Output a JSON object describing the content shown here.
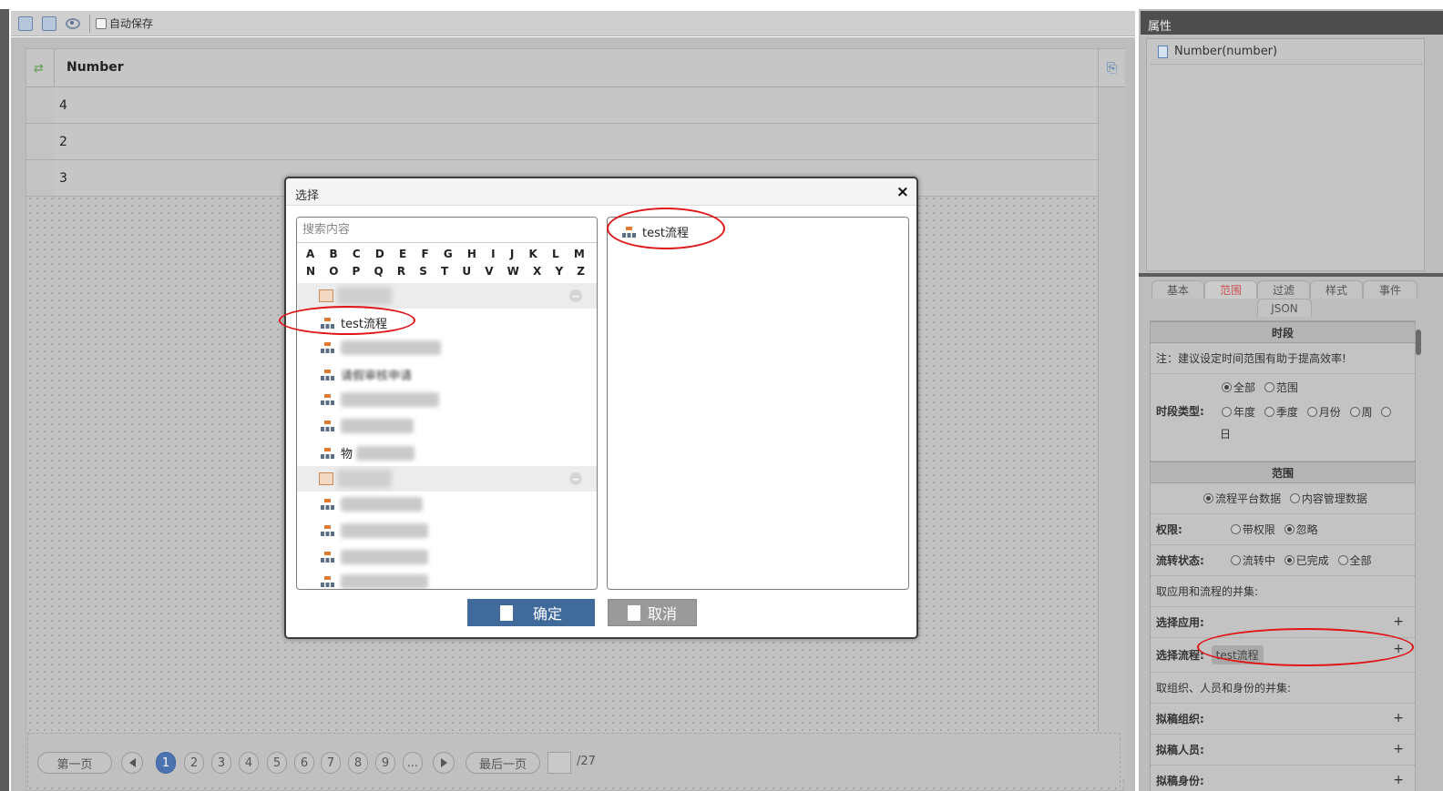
{
  "toolbar": {
    "autosave_label": "自动保存"
  },
  "grid": {
    "column_title": "Number",
    "rows": [
      "4",
      "2",
      "3"
    ]
  },
  "pager": {
    "first": "第一页",
    "pages": [
      "1",
      "2",
      "3",
      "4",
      "5",
      "6",
      "7",
      "8",
      "9"
    ],
    "ellipsis": "...",
    "last": "最后一页",
    "total": "/27",
    "current": "1"
  },
  "dialog": {
    "title": "选择",
    "close": "×",
    "search_placeholder": "搜索内容",
    "letters_row1": [
      "A",
      "B",
      "C",
      "D",
      "E",
      "F",
      "G",
      "H",
      "I",
      "J",
      "K",
      "L",
      "M"
    ],
    "letters_row2": [
      "N",
      "O",
      "P",
      "Q",
      "R",
      "S",
      "T",
      "U",
      "V",
      "W",
      "X",
      "Y",
      "Z"
    ],
    "highlighted_item": "test流程",
    "partial_item_1": "请假审核申请",
    "partial_item_2": "物",
    "selected_item": "test流程",
    "ok_label": "确定",
    "cancel_label": "取消"
  },
  "properties": {
    "header": "属性",
    "item": "Number(number)",
    "tabs": [
      "基本",
      "范围",
      "过滤",
      "样式",
      "事件",
      "JSON"
    ],
    "active_tab": "范围",
    "section_period": "时段",
    "note": "注：建议设定时间范围有助于提高效率!",
    "period_opts": [
      "全部",
      "范围"
    ],
    "period_type_label": "时段类型:",
    "period_type_opts": [
      "年度",
      "季度",
      "月份",
      "周",
      "日"
    ],
    "section_scope": "范围",
    "scope_opts": [
      "流程平台数据",
      "内容管理数据"
    ],
    "perm_label": "权限:",
    "perm_opts": [
      "带权限",
      "忽略"
    ],
    "status_label": "流转状态:",
    "status_opts": [
      "流转中",
      "已完成",
      "全部"
    ],
    "union_app_text": "取应用和流程的并集:",
    "select_app_label": "选择应用:",
    "select_process_label": "选择流程:",
    "selected_process_tag": "test流程",
    "union_org_text": "取组织、人员和身份的并集:",
    "draft_org_label": "拟稿组织:",
    "draft_person_label": "拟稿人员:",
    "draft_identity_label": "拟稿身份:",
    "plus": "+"
  },
  "colors": {
    "accent": "#4a73b0",
    "annotation": "#e01515",
    "active_tab": "#cc5555"
  }
}
